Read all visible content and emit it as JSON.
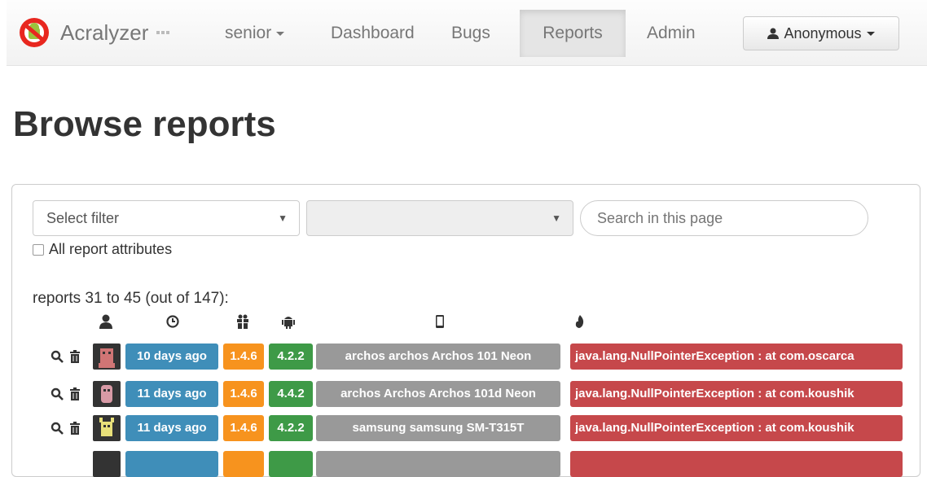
{
  "app": {
    "brand": "Acralyzer",
    "app_selector": "senior",
    "nav": [
      "Dashboard",
      "Bugs",
      "Reports",
      "Admin"
    ],
    "active_nav": "Reports",
    "user": "Anonymous"
  },
  "page": {
    "title": "Browse reports",
    "filter_placeholder": "Select filter",
    "filter_value": "",
    "search_placeholder": "Search in this page",
    "all_attributes_label": "All report attributes",
    "count_text": "reports 31 to 45 (out of 147):"
  },
  "columns": [
    "user-icon",
    "clock-icon",
    "gift-icon",
    "android-icon",
    "phone-icon",
    "fire-icon"
  ],
  "reports": [
    {
      "age": "10 days ago",
      "app_version": "1.4.6",
      "android_version": "4.2.2",
      "device": "archos archos Archos 101 Neon",
      "exception": "java.lang.NullPointerException : at com.oscarca"
    },
    {
      "age": "11 days ago",
      "app_version": "1.4.6",
      "android_version": "4.4.2",
      "device": "archos Archos Archos 101d Neon",
      "exception": "java.lang.NullPointerException : at com.koushik"
    },
    {
      "age": "11 days ago",
      "app_version": "1.4.6",
      "android_version": "4.2.2",
      "device": "samsung samsung SM-T315T",
      "exception": "java.lang.NullPointerException : at com.koushik"
    }
  ],
  "colors": {
    "age": "#3f8eb9",
    "app_version": "#f7931e",
    "android_version": "#3e9a47",
    "device": "#999999",
    "exception": "#c6484b"
  }
}
